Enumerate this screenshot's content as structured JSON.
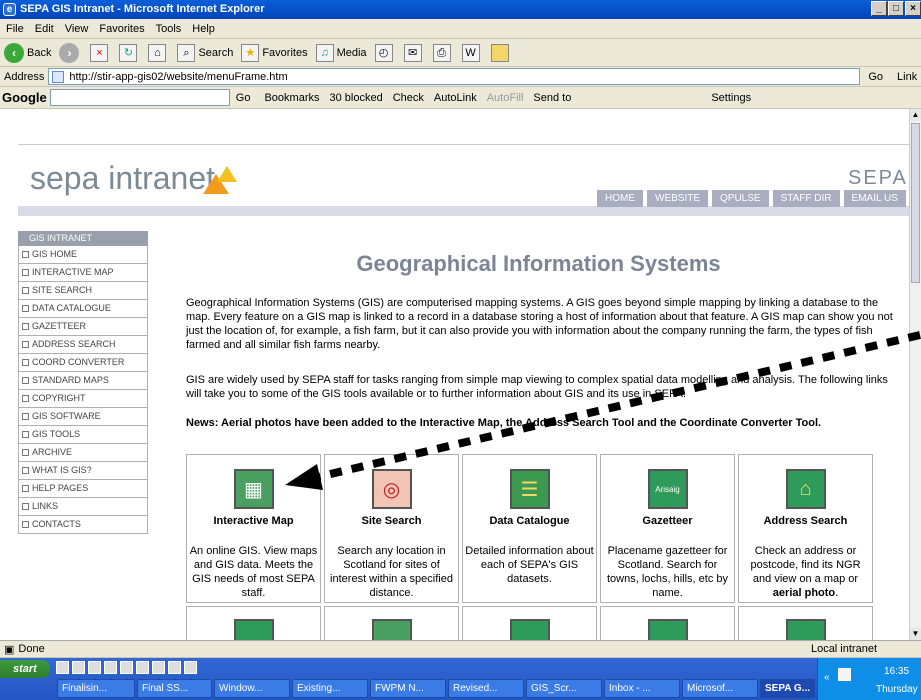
{
  "window": {
    "title": "SEPA GIS Intranet - Microsoft Internet Explorer",
    "buttons": [
      "_",
      "×‑",
      "×"
    ]
  },
  "menubar": [
    "File",
    "Edit",
    "View",
    "Favorites",
    "Tools",
    "Help"
  ],
  "toolbar": {
    "back": "Back",
    "search": "Search",
    "favorites": "Favorites",
    "media": "Media"
  },
  "address": {
    "label": "Address",
    "url": "http://stir-app-gis02/website/menuFrame.htm",
    "go": "Go",
    "links": "Link"
  },
  "googlebar": {
    "logo": "Google",
    "go": "Go",
    "bookmarks": "Bookmarks",
    "blocked": "30 blocked",
    "check": "Check",
    "autolink": "AutoLink",
    "autofill": "AutoFill",
    "sendto": "Send to",
    "settings": "Settings"
  },
  "site": {
    "logo": "sepa intranet",
    "brand": "SEPA",
    "nav": [
      "HOME",
      "WEBSITE",
      "QPULSE",
      "STAFF DIR",
      "EMAIL US"
    ]
  },
  "sidenav": {
    "header": "GIS INTRANET",
    "items": [
      "GIS HOME",
      "INTERACTIVE MAP",
      "SITE SEARCH",
      "DATA CATALOGUE",
      "GAZETTEER",
      "ADDRESS SEARCH",
      "COORD CONVERTER",
      "STANDARD MAPS",
      "COPYRIGHT",
      "GIS SOFTWARE",
      "GIS TOOLS",
      "ARCHIVE",
      "WHAT IS GIS?",
      "HELP PAGES",
      "LINKS",
      "CONTACTS"
    ]
  },
  "main": {
    "title": "Geographical Information Systems",
    "para1": "Geographical Information Systems (GIS) are computerised mapping systems. A GIS goes beyond simple mapping by linking a database to the map. Every feature on a GIS map is linked to a record in a database storing a host of information about that feature. A GIS map can show you not just the location of, for example, a fish farm, but it can also provide you with information about the company running the farm, the types of fish farmed and all similar fish farms nearby.",
    "para2": "GIS are widely used by SEPA staff for tasks ranging from simple map viewing to complex spatial data modelling and analysis. The following links will take you to some of the GIS tools available or to further information about GIS and its use in SEPA.",
    "news": "News: Aerial photos have been added to the Interactive Map, the Address Search Tool and the Coordinate Converter Tool.",
    "cards": [
      {
        "title": "Interactive Map",
        "desc": "An online GIS. View maps and GIS data. Meets the GIS needs of most SEPA staff.",
        "icon": "map-icon"
      },
      {
        "title": "Site Search",
        "desc": "Search any location in Scotland for sites of interest within a specified distance.",
        "icon": "target-icon"
      },
      {
        "title": "Data Catalogue",
        "desc": "Detailed information about each of SEPA's GIS datasets.",
        "icon": "catalogue-icon"
      },
      {
        "title": "Gazetteer",
        "desc": "Placename gazetteer for Scotland. Search for towns, lochs, hills, etc by name.",
        "icon": "sign-icon",
        "badge": "Arisaig"
      },
      {
        "title": "Address Search",
        "desc_prefix": "Check an address or postcode, find its NGR and view on a map or ",
        "desc_bold": "aerial photo",
        "desc_suffix": ".",
        "icon": "house-icon"
      }
    ]
  },
  "status": {
    "left": "Done",
    "right": "Local intranet"
  },
  "taskbar": {
    "start": "start",
    "tasks": [
      "Finalisin...",
      "Final SS...",
      "Window...",
      "Existing...",
      "FWPM N...",
      "Revised...",
      "GIS_Scr...",
      "Inbox - ...",
      "Microsof...",
      "SEPA G..."
    ],
    "time": "16:35",
    "day": "Thursday"
  },
  "colors": {
    "title_grey": "#7b8595",
    "nav_button": "#a8aec0",
    "sidenav_head": "#99a0ac",
    "logo_orange": "#f39b1f"
  }
}
